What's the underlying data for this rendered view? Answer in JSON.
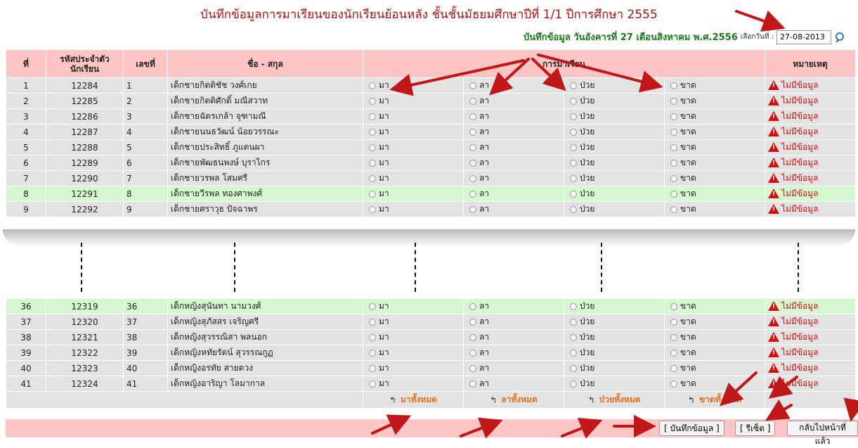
{
  "header": {
    "title": "บันทึกข้อมูลการมาเรียนของนักเรียนย้อนหลัง ชั้นชั้นมัธยมศึกษาปีที่ 1/1 ปีการศึกษา 2555",
    "record_label": "บันทึกข้อมูล วันอังคารที่ 27 เดือนสิงหาคม พ.ศ.2556",
    "pick_date_label": "เลือกวันที่ :",
    "date_value": "27-08-2013"
  },
  "columns": {
    "no": "ที่",
    "student_id": "รหัสประจำตัวนักเรียน",
    "number": "เลขที่",
    "name": "ชื่อ - สกุล",
    "attendance": "การมาเรียน",
    "note": "หมายเหตุ"
  },
  "options": {
    "present": "มา",
    "leave": "ลา",
    "sick": "ป่วย",
    "absent": "ขาด"
  },
  "note_text": "ไม่มีข้อมูล",
  "rows_top": [
    {
      "no": "1",
      "id": "12284",
      "num": "1",
      "name": "เด็กชายกิตติชัช วงศ์เกย"
    },
    {
      "no": "2",
      "id": "12285",
      "num": "2",
      "name": "เด็กชายกิตติศักดิ์ มณีสวาท"
    },
    {
      "no": "3",
      "id": "12286",
      "num": "3",
      "name": "เด็กชายฉัตรเกล้า จุฑามณี"
    },
    {
      "no": "4",
      "id": "12287",
      "num": "4",
      "name": "เด็กชายนนธวัฒน์ น้อยวรรณะ"
    },
    {
      "no": "5",
      "id": "12288",
      "num": "5",
      "name": "เด็กชายประสิทธิ์ ภูแดนผา"
    },
    {
      "no": "6",
      "id": "12289",
      "num": "6",
      "name": "เด็กชายพัฒธนพงษ์ บุราไกร"
    },
    {
      "no": "7",
      "id": "12290",
      "num": "7",
      "name": "เด็กชายวรพล โสมศรี"
    },
    {
      "no": "8",
      "id": "12291",
      "num": "8",
      "name": "เด็กชายวีรพล ทองศาพงศ์"
    },
    {
      "no": "9",
      "id": "12292",
      "num": "9",
      "name": "เด็กชายศราวุธ ปัจฉาพร"
    }
  ],
  "rows_bottom": [
    {
      "no": "36",
      "id": "12319",
      "num": "36",
      "name": "เด็กหญิงสุนันทา นามวงศ์"
    },
    {
      "no": "37",
      "id": "12320",
      "num": "37",
      "name": "เด็กหญิงสุภัสสร เจริญศรี"
    },
    {
      "no": "38",
      "id": "12321",
      "num": "38",
      "name": "เด็กหญิงสุวรรณิสา พลนอก"
    },
    {
      "no": "39",
      "id": "12322",
      "num": "39",
      "name": "เด็กหญิงหทัยรัตน์ สุวรรณกูฏ"
    },
    {
      "no": "40",
      "id": "12323",
      "num": "40",
      "name": "เด็กหญิงอรทัย สายดวง"
    },
    {
      "no": "41",
      "id": "12324",
      "num": "41",
      "name": "เด็กหญิงอาริญา โลมากาล"
    }
  ],
  "select_all": {
    "present": "มาทั้งหมด",
    "leave": "ลาทั้งหมด",
    "sick": "ป่วยทั้งหมด",
    "absent": "ขาดทั้งหมด"
  },
  "actions": {
    "save": "[ บันทึกข้อมูล ]",
    "reset": "[ รีเซ็ต ]",
    "back": "กลับไปหน้าที่แล้ว"
  },
  "colors": {
    "title": "#b01010",
    "record": "#1a7a1a",
    "header_bg": "#ffc4c4",
    "row_gray": "#e3e3e3",
    "row_green": "#d6f8d0",
    "note": "#d01010",
    "select_all": "#e07020",
    "annotation_arrow": "#c01818"
  }
}
